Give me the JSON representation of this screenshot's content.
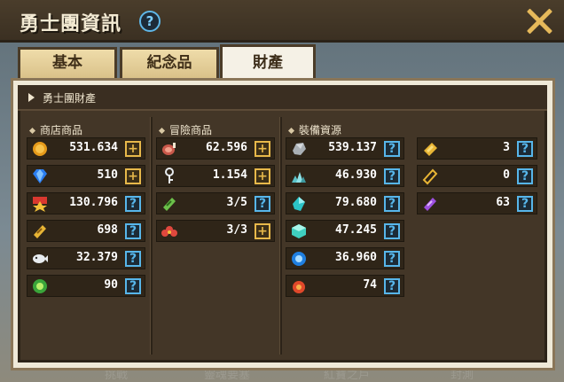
{
  "window": {
    "title": "勇士團資訊",
    "help": "?",
    "close": "close-icon"
  },
  "tabs": [
    {
      "label": "基本",
      "active": false
    },
    {
      "label": "紀念品",
      "active": false
    },
    {
      "label": "財產",
      "active": true
    }
  ],
  "panel": {
    "header": "勇士團財產",
    "sections": {
      "shop": {
        "title": "商店商品",
        "items": [
          {
            "icon": "gold-coin-icon",
            "value": "531.634",
            "action": "+"
          },
          {
            "icon": "blue-gem-icon",
            "value": "510",
            "action": "+"
          },
          {
            "icon": "red-medal-icon",
            "value": "130.796",
            "action": "?"
          },
          {
            "icon": "gold-ticket-icon",
            "value": "698",
            "action": "?"
          },
          {
            "icon": "white-fish-icon",
            "value": "32.379",
            "action": "?"
          },
          {
            "icon": "green-orb-icon",
            "value": "90",
            "action": "?"
          }
        ]
      },
      "adventure": {
        "title": "冒險商品",
        "items": [
          {
            "icon": "meat-icon",
            "value": "62.596",
            "action": "+"
          },
          {
            "icon": "key-icon",
            "value": "1.154",
            "action": "+"
          },
          {
            "icon": "green-ticket-icon",
            "value": "3/5",
            "action": "?"
          },
          {
            "icon": "red-flower-icon",
            "value": "3/3",
            "action": "+"
          }
        ]
      },
      "equipment": {
        "title": "裝備資源",
        "items": [
          {
            "icon": "stone-icon",
            "value": "539.137",
            "action": "?"
          },
          {
            "icon": "crystal-pile-icon",
            "value": "46.930",
            "action": "?"
          },
          {
            "icon": "cyan-shard-icon",
            "value": "79.680",
            "action": "?"
          },
          {
            "icon": "aqua-cube-icon",
            "value": "47.245",
            "action": "?"
          },
          {
            "icon": "blue-ring-icon",
            "value": "36.960",
            "action": "?"
          },
          {
            "icon": "fire-orb-icon",
            "value": "74",
            "action": "?"
          }
        ],
        "extra": [
          {
            "icon": "gold-coupon-icon",
            "value": "3",
            "action": "?"
          },
          {
            "icon": "gold-scroll-icon",
            "value": "0",
            "action": "?"
          },
          {
            "icon": "purple-ticket-icon",
            "value": "63",
            "action": "?"
          }
        ]
      }
    }
  },
  "background_text": [
    "挑戰",
    "靈魂要塞",
    "紅寶之戶",
    "封測"
  ]
}
